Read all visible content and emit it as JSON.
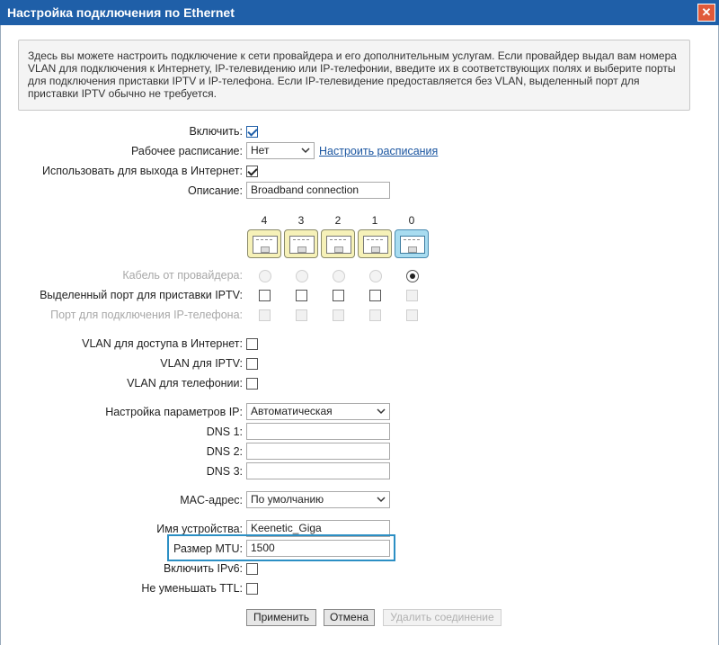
{
  "window": {
    "title": "Настройка подключения по Ethernet"
  },
  "info_text": "Здесь вы можете настроить подключение к сети провайдера и его дополнительным услугам. Если провайдер выдал вам номера VLAN для подключения к Интернету, IP-телевидению или IP-телефонии, введите их в соответствующих полях и выберите порты для подключения приставки IPTV и IP-телефона. Если IP-телевидение предоставляется без VLAN, выделенный порт для приставки IPTV обычно не требуется.",
  "form": {
    "enable_label": "Включить:",
    "enable_checked": true,
    "schedule_label": "Рабочее расписание:",
    "schedule_value": "Нет",
    "schedule_link": "Настроить расписания",
    "internet_label": "Использовать для выхода в Интернет:",
    "internet_checked": true,
    "description_label": "Описание:",
    "description_value": "Broadband connection"
  },
  "ports": {
    "numbers": [
      "4",
      "3",
      "2",
      "1",
      "0"
    ],
    "active_port": "0",
    "provider_cable_label": "Кабель от провайдера:",
    "iptv_port_label": "Выделенный порт для приставки IPTV:",
    "phone_port_label": "Порт для подключения IP-телефона:"
  },
  "vlan": {
    "internet_label": "VLAN для доступа в Интернет:",
    "iptv_label": "VLAN для IPTV:",
    "phone_label": "VLAN для телефонии:"
  },
  "ip": {
    "settings_label": "Настройка параметров IP:",
    "settings_value": "Автоматическая",
    "dns1_label": "DNS 1:",
    "dns2_label": "DNS 2:",
    "dns3_label": "DNS 3:",
    "mac_label": "MAC-адрес:",
    "mac_value": "По умолчанию",
    "device_name_label": "Имя устройства:",
    "device_name_value": "Keenetic_Giga",
    "mtu_label": "Размер MTU:",
    "mtu_value": "1500",
    "ipv6_label": "Включить IPv6:",
    "ttl_label": "Не уменьшать TTL:"
  },
  "buttons": {
    "apply": "Применить",
    "cancel": "Отмена",
    "delete": "Удалить соединение"
  },
  "colors": {
    "titlebar": "#1f5fa8",
    "highlight": "#2c8fc4",
    "port_active": "#a8dcf0",
    "port_idle": "#f6f1b8"
  }
}
